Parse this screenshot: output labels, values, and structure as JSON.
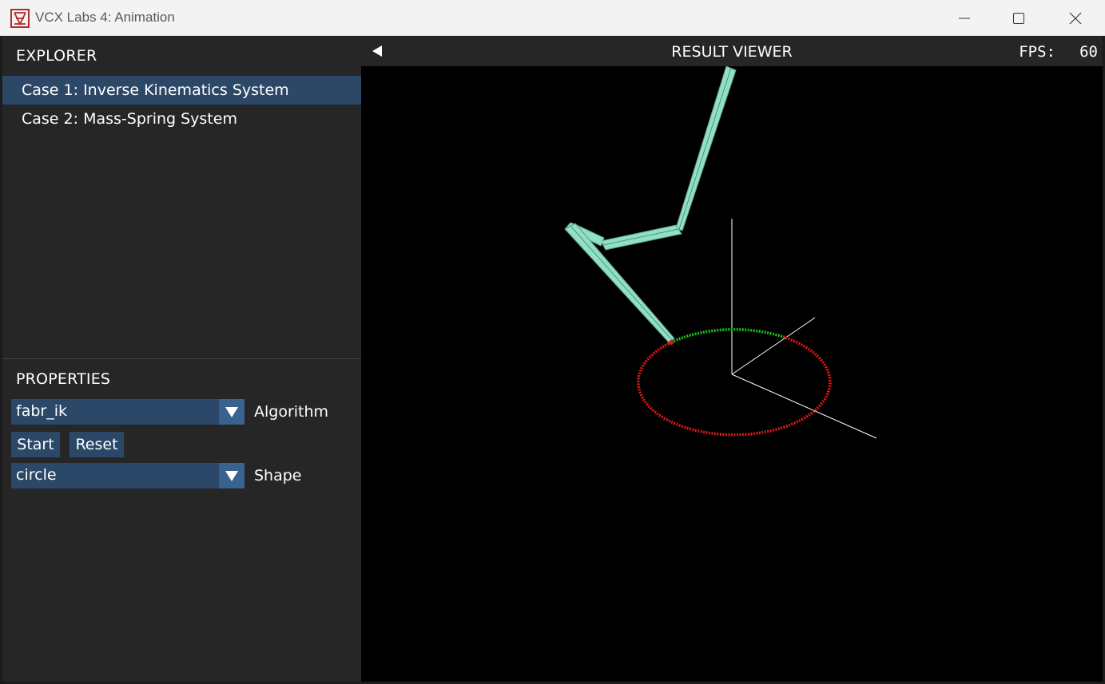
{
  "window": {
    "title": "VCX Labs 4: Animation",
    "app_icon": "app-logo-icon",
    "controls": [
      "minimize-icon",
      "maximize-icon",
      "close-icon"
    ]
  },
  "explorer": {
    "title": "EXPLORER",
    "items": [
      {
        "label": "Case 1: Inverse Kinematics System",
        "selected": true
      },
      {
        "label": "Case 2: Mass-Spring System",
        "selected": false
      }
    ]
  },
  "properties": {
    "title": "PROPERTIES",
    "algorithm": {
      "value": "fabr_ik",
      "label": "Algorithm"
    },
    "start_label": "Start",
    "reset_label": "Reset",
    "shape": {
      "value": "circle",
      "label": "Shape"
    }
  },
  "viewer": {
    "title": "RESULT VIEWER",
    "fps_label": "FPS:",
    "fps_value": "60"
  },
  "colors": {
    "accent": "#2c4866",
    "arm": "#8fe0c4",
    "trajectory_done": "#19c419",
    "trajectory_pending": "#e01818",
    "axes": "#ffffff"
  }
}
